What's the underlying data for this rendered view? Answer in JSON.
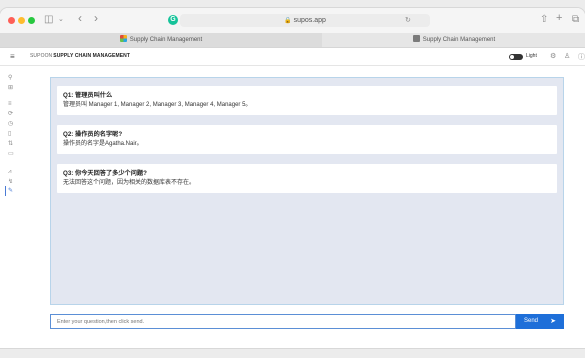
{
  "browser": {
    "address": "supos.app",
    "tabs": [
      {
        "label": "Supply Chain Management"
      },
      {
        "label": "Supply Chain Management"
      }
    ]
  },
  "header": {
    "brand_prefix": "SUPOON",
    "title": "SUPPLY CHAIN MANAGEMENT",
    "theme_label": "Light"
  },
  "chat": {
    "messages": [
      {
        "question": "Q1: 管理员叫什么",
        "answer": "管理员叫 Manager 1, Manager 2, Manager 3, Manager 4, Manager 5。"
      },
      {
        "question": "Q2: 操作员的名字呢?",
        "answer": "操作员的名字是Agatha.Nair。"
      },
      {
        "question": "Q3: 你今天回答了多少个问题?",
        "answer": "无法回答这个问题，因为相关的数据库表不存在。"
      }
    ],
    "input_placeholder": "Enter your question,then click send.",
    "send_label": "Send",
    "send_icon": "➤"
  },
  "icons": {
    "back": "‹",
    "forward": "›",
    "sidebar_toggle": "◫",
    "share": "⇧",
    "new_tab": "+",
    "tabs_overview": "⧉",
    "menu": "≡",
    "settings": "⚙",
    "user": "♙",
    "info": "ⓘ"
  }
}
